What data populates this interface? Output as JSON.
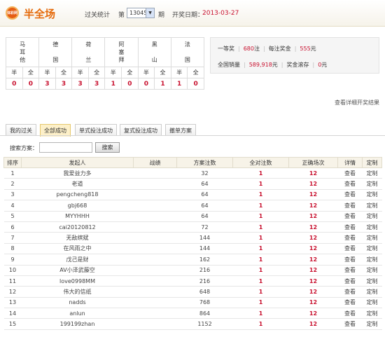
{
  "header": {
    "logo_text": "体彩网",
    "title": "半全场",
    "stats_label": "过关统计",
    "issue_prefix": "第",
    "issue_value": "13045",
    "issue_suffix": "期",
    "date_label": "开奖日期：",
    "date_value": "2013-03-27"
  },
  "matches": {
    "teams": [
      [
        "马",
        "耳",
        "他"
      ],
      [
        "德",
        "",
        "国"
      ],
      [
        "荷",
        "",
        "兰"
      ],
      [
        "阿",
        "塞",
        "拜"
      ],
      [
        "黑",
        "",
        "山"
      ],
      [
        "法",
        "",
        "国"
      ]
    ],
    "half_label": "半",
    "full_label": "全",
    "results": [
      "0",
      "0",
      "3",
      "3",
      "3",
      "3",
      "1",
      "0",
      "0",
      "1",
      "1",
      "0"
    ]
  },
  "prize": {
    "first_label": "一等奖",
    "first_count": "680",
    "first_unit": "注",
    "per_bet_label": "每注奖金",
    "per_bet_amount": "555",
    "per_bet_unit": "元",
    "sales_label": "全国销量",
    "sales_amount": "589,918",
    "sales_unit": "元",
    "pool_label": "奖金滚存",
    "pool_amount": "0",
    "pool_unit": "元"
  },
  "detail_link": "查看详细开奖结果",
  "tabs": [
    "我的过关",
    "全部成功",
    "单式投注成功",
    "复式投注成功",
    "撤单方案"
  ],
  "active_tab": 1,
  "search": {
    "label": "搜索方案：",
    "value": "",
    "button": "搜索"
  },
  "table": {
    "headers": [
      "排序",
      "发起人",
      "战绩",
      "方案注数",
      "全对注数",
      "正确场次",
      "详情",
      "定制"
    ],
    "rows": [
      [
        "1",
        "我爱益力多",
        "",
        "32",
        "1",
        "12",
        "查看",
        "定制"
      ],
      [
        "2",
        "老道",
        "",
        "64",
        "1",
        "12",
        "查看",
        "定制"
      ],
      [
        "3",
        "pengcheng818",
        "",
        "64",
        "1",
        "12",
        "查看",
        "定制"
      ],
      [
        "4",
        "gbj668",
        "",
        "64",
        "1",
        "12",
        "查看",
        "定制"
      ],
      [
        "5",
        "MYYHHH",
        "",
        "64",
        "1",
        "12",
        "查看",
        "定制"
      ],
      [
        "6",
        "cai20120812",
        "",
        "72",
        "1",
        "12",
        "查看",
        "定制"
      ],
      [
        "7",
        "无敌缤斌",
        "",
        "144",
        "1",
        "12",
        "查看",
        "定制"
      ],
      [
        "8",
        "在风雨之中",
        "",
        "144",
        "1",
        "12",
        "查看",
        "定制"
      ],
      [
        "9",
        "戊己是财",
        "",
        "162",
        "1",
        "12",
        "查看",
        "定制"
      ],
      [
        "10",
        "AV小泽武藤空",
        "",
        "216",
        "1",
        "12",
        "查看",
        "定制"
      ],
      [
        "11",
        "love0998MM",
        "",
        "216",
        "1",
        "12",
        "查看",
        "定制"
      ],
      [
        "12",
        "伟大的信纸",
        "",
        "648",
        "1",
        "12",
        "查看",
        "定制"
      ],
      [
        "13",
        "nadds",
        "",
        "768",
        "1",
        "12",
        "查看",
        "定制"
      ],
      [
        "14",
        "anlun",
        "",
        "864",
        "1",
        "12",
        "查看",
        "定制"
      ],
      [
        "15",
        "199199zhan",
        "",
        "1152",
        "1",
        "12",
        "查看",
        "定制"
      ]
    ]
  },
  "colors": {
    "accent": "#e56a0b",
    "highlight": "#c8102e",
    "tab_active_bg": "#fdf0c9",
    "header_row_bg": "#f7f3e8"
  }
}
